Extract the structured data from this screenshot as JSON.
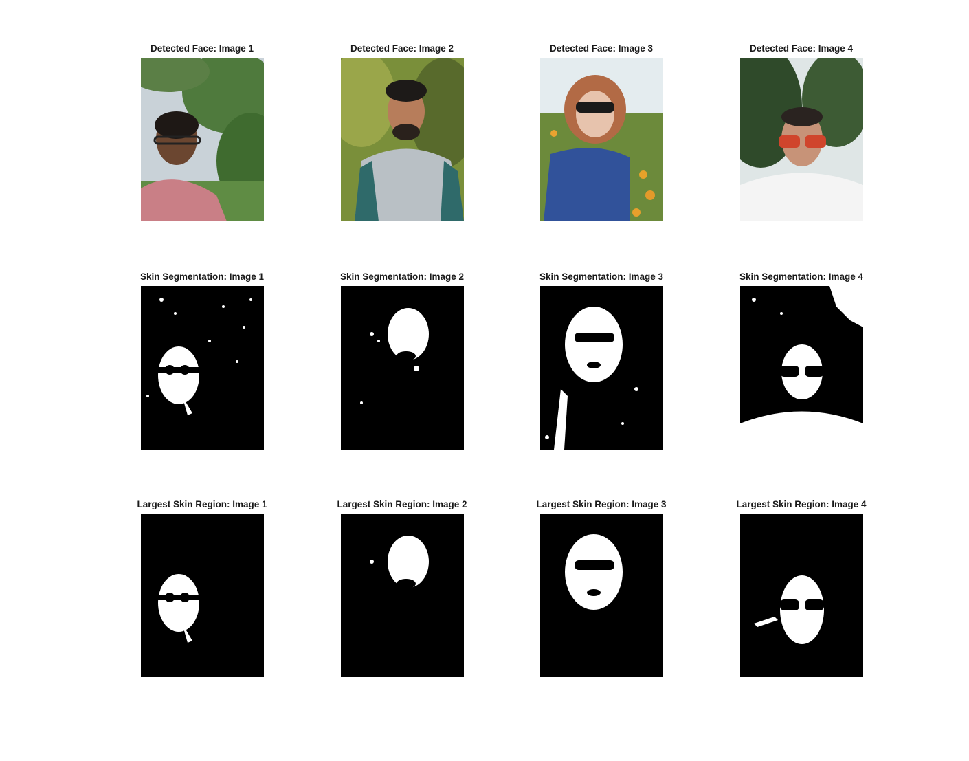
{
  "figure": {
    "rows": [
      {
        "row_name": "detected-face",
        "titles": [
          "Detected Face: Image 1",
          "Detected Face: Image 2",
          "Detected Face: Image 3",
          "Detected Face: Image 4"
        ],
        "kind": "photo"
      },
      {
        "row_name": "skin-segmentation",
        "titles": [
          "Skin Segmentation: Image 1",
          "Skin Segmentation: Image 2",
          "Skin Segmentation: Image 3",
          "Skin Segmentation: Image 4"
        ],
        "kind": "mask"
      },
      {
        "row_name": "largest-skin-region",
        "titles": [
          "Largest Skin Region: Image 1",
          "Largest Skin Region: Image 2",
          "Largest Skin Region: Image 3",
          "Largest Skin Region: Image 4"
        ],
        "kind": "mask"
      }
    ]
  },
  "colors": {
    "background": "#ffffff",
    "title_text": "#1a1a1a",
    "mask_background": "#000000",
    "mask_foreground": "#ffffff"
  }
}
